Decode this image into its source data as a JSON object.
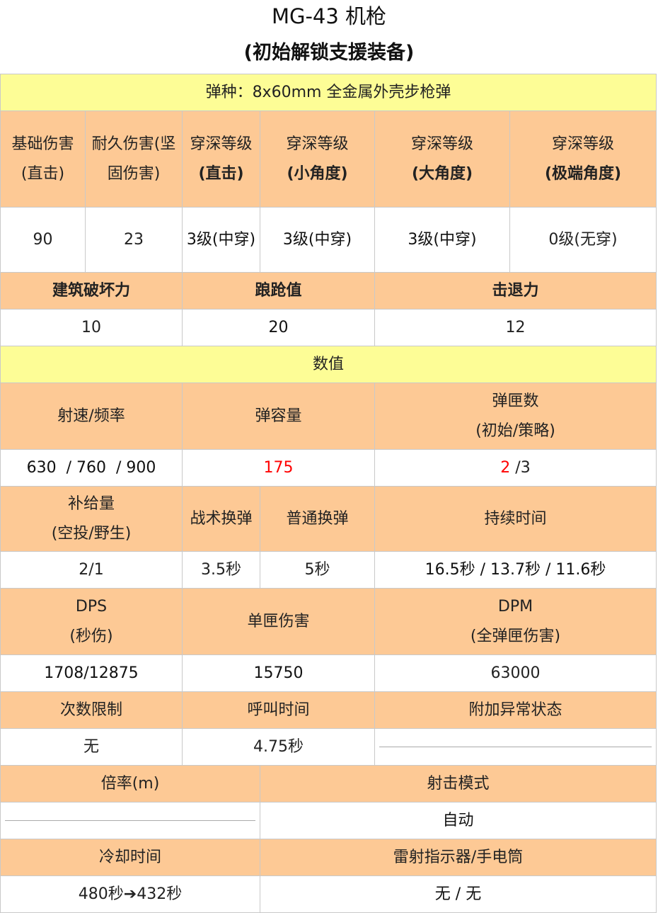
{
  "title": "MG-43 机枪",
  "subtitle": "(初始解锁支援装备)",
  "ammo_type": "弹种：8x60mm 全金属外壳步枪弹",
  "damage_headers": {
    "base_damage": "基础伤害(直击)",
    "durable_damage": "耐久伤害(坚固伤害)",
    "pen_direct_1": "穿深等级",
    "pen_direct_2": "(直击)",
    "pen_small_1": "穿深等级",
    "pen_small_2": "(小角度)",
    "pen_large_1": "穿深等级",
    "pen_large_2": "(大角度)",
    "pen_extreme_1": "穿深等级",
    "pen_extreme_2": "(极端角度)"
  },
  "damage_values": {
    "base_damage": "90",
    "durable_damage": "23",
    "pen_direct": "3级(中穿)",
    "pen_small": "3级(中穿)",
    "pen_large": "3级(中穿)",
    "pen_extreme": "0级(无穿)"
  },
  "impact_headers": {
    "demolition": "建筑破坏力",
    "stagger": "踉跄值",
    "push": "击退力"
  },
  "impact_values": {
    "demolition": "10",
    "stagger": "20",
    "push": "12"
  },
  "stats_section": "数值",
  "fire_headers": {
    "rpm": "射速/频率",
    "capacity": "弹容量",
    "mags_1": "弹匣数",
    "mags_2": "(初始/策略)"
  },
  "fire_values": {
    "rpm": "630  / 760  / 900",
    "capacity": "175",
    "mags_initial": "2",
    "mags_rest": " /3"
  },
  "reload_headers": {
    "resupply_1": "补给量",
    "resupply_2": "(空投/野生)",
    "tactical": "战术换弹",
    "normal": "普通换弹",
    "duration": "持续时间"
  },
  "reload_values": {
    "resupply": "2/1",
    "tactical": "3.5秒",
    "normal": "5秒",
    "duration": "16.5秒 / 13.7秒 / 11.6秒"
  },
  "dps_headers": {
    "dps_1": "DPS",
    "dps_2": "(秒伤)",
    "mag_damage": "单匣伤害",
    "dpm_1": "DPM",
    "dpm_2": "(全弹匣伤害)"
  },
  "dps_values": {
    "dps": "1708/12875",
    "mag_damage": "15750",
    "dpm": "63000"
  },
  "limit_headers": {
    "uses": "次数限制",
    "call_time": "呼叫时间",
    "status": "附加异常状态"
  },
  "limit_values": {
    "uses": "无",
    "call_time": "4.75秒",
    "status": ""
  },
  "scope_headers": {
    "zoom": "倍率(m)",
    "fire_mode": "射击模式"
  },
  "scope_values": {
    "zoom": "",
    "fire_mode": "自动"
  },
  "cooldown_headers": {
    "cooldown": "冷却时间",
    "laser": "雷射指示器/手电筒"
  },
  "cooldown_values": {
    "cooldown": "480秒➔432秒",
    "laser": "无 / 无"
  }
}
